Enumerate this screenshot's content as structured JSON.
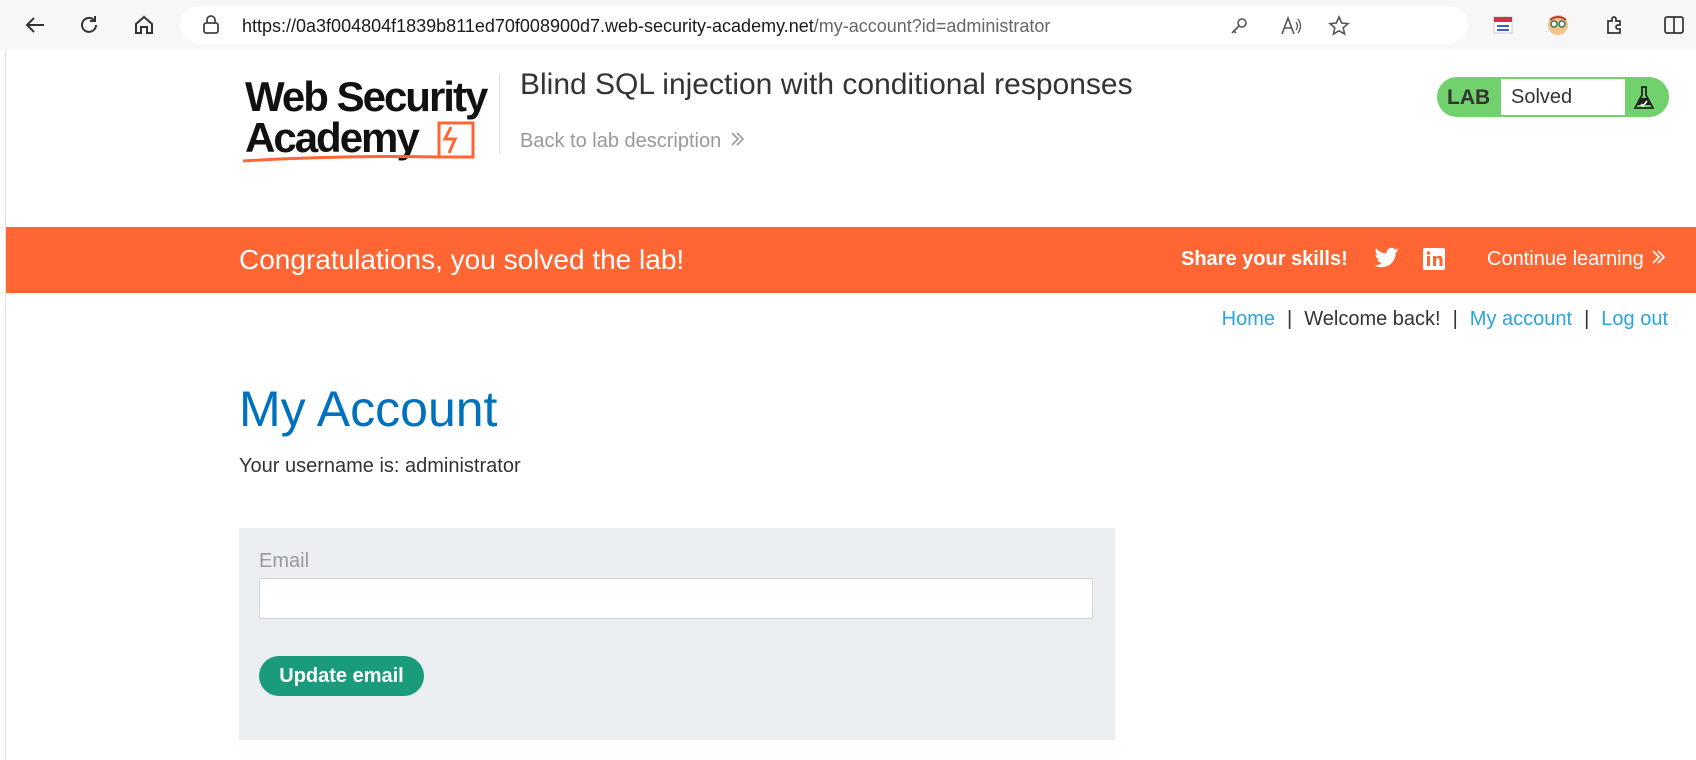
{
  "browser": {
    "url_host": "https://0a3f004804f1839b811ed70f008900d7.web-security-academy.net",
    "url_path": "/my-account?id=administrator"
  },
  "header": {
    "lab_title": "Blind SQL injection with conditional responses",
    "back_link": "Back to lab description",
    "badge_label": "LAB",
    "badge_status": "Solved",
    "logo_text": "Web Security Academy"
  },
  "banner": {
    "message": "Congratulations, you solved the lab!",
    "share": "Share your skills!",
    "continue": "Continue learning"
  },
  "nav": {
    "home": "Home",
    "sep": "|",
    "welcome": "Welcome back!",
    "my_account": "My account",
    "logout": "Log out"
  },
  "main": {
    "title": "My Account",
    "username_line": "Your username is: administrator",
    "email_label": "Email",
    "email_value": "",
    "update_button": "Update email"
  },
  "colors": {
    "orange": "#ff6633",
    "badge_green": "#70d16d",
    "link_blue": "#29a4dd",
    "title_blue": "#0071bc",
    "button_green": "#1a9c7c"
  }
}
